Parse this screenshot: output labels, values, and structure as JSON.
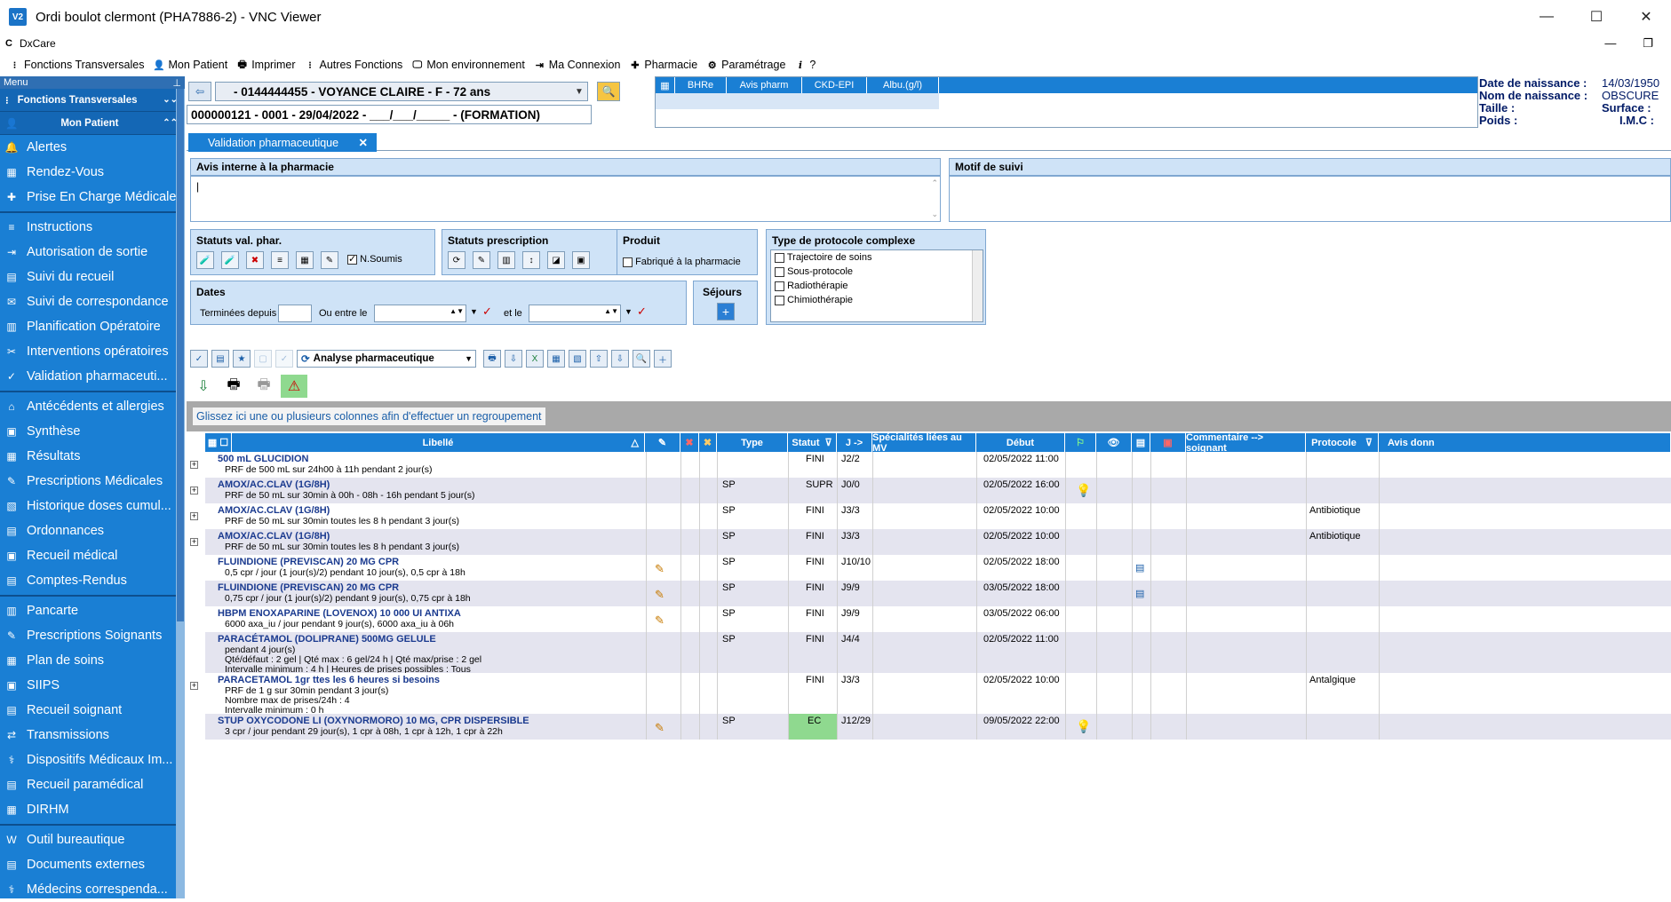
{
  "window": {
    "title": "Ordi boulot clermont (PHA7886-2) - VNC Viewer",
    "app_icon": "V2",
    "controls": [
      "—",
      "☐",
      "✕"
    ]
  },
  "dx": {
    "c": "C",
    "name": "DxCare",
    "controls": [
      "—",
      "❐"
    ]
  },
  "menubar": [
    {
      "icon": "⁝",
      "label": "Fonctions Transversales"
    },
    {
      "icon": "👤",
      "label": "Mon Patient"
    },
    {
      "icon": "🖶",
      "label": "Imprimer"
    },
    {
      "icon": "⁝",
      "label": "Autres Fonctions"
    },
    {
      "icon": "🖵",
      "label": "Mon environnement"
    },
    {
      "icon": "⇥",
      "label": "Ma Connexion"
    },
    {
      "icon": "✚",
      "label": "Pharmacie"
    },
    {
      "icon": "⚙",
      "label": "Paramétrage"
    },
    {
      "icon": "i",
      "label": "?"
    }
  ],
  "sidebar": {
    "header": "Menu",
    "pin": "⊥",
    "sections": [
      {
        "label": "Fonctions Transversales",
        "chev": "⌄⌄"
      },
      {
        "label": "Mon Patient",
        "chev": "⌃⌃"
      }
    ],
    "groups": [
      [
        "Alertes",
        "Rendez-Vous",
        "Prise En Charge Médicale"
      ],
      [
        "Instructions",
        "Autorisation de sortie",
        "Suivi du recueil",
        "Suivi de correspondance",
        "Planification Opératoire",
        "Interventions opératoires",
        "Validation  pharmaceuti..."
      ],
      [
        "Antécédents et allergies",
        "Synthèse",
        "Résultats",
        "Prescriptions Médicales",
        "Historique doses cumul...",
        "Ordonnances",
        "Recueil médical",
        "Comptes-Rendus"
      ],
      [
        "Pancarte",
        "Prescriptions Soignants",
        "Plan de soins",
        "SIIPS",
        "Recueil soignant",
        "Transmissions",
        "Dispositifs Médicaux Im...",
        "Recueil paramédical",
        "DIRHM"
      ],
      [
        "Outil bureautique",
        "Documents externes",
        "Médecins  correspenda..."
      ]
    ]
  },
  "patient": {
    "selector": "- 0144444455 - VOYANCE CLAIRE - F - 72 ans",
    "stay": "000000121 - 0001 - 29/04/2022 - ___/___/_____ - (FORMATION)"
  },
  "minitable": {
    "headers": [
      "BHRe",
      "Avis pharm",
      "CKD-EPI",
      "Albu.(g/l)"
    ]
  },
  "info": {
    "birth_label": "Date de naissance :",
    "birth_value": "14/03/1950",
    "birthname_label": "Nom de naissance :",
    "birthname_value": "OBSCURE",
    "height_label": "Taille :",
    "surface_label": "Surface :",
    "weight_label": "Poids :",
    "imc_label": "I.M.C :"
  },
  "tab": {
    "label": "Validation pharmaceutique",
    "close": "✕"
  },
  "panels": {
    "avis_title": "Avis interne à la pharmacie",
    "motif_title": "Motif de suivi"
  },
  "filters": {
    "statuts_val": "Statuts val. phar.",
    "n_soumis": "N.Soumis",
    "statuts_presc": "Statuts prescription",
    "produit": "Produit",
    "fabrique": "Fabriqué à la pharmacie",
    "type_proto": "Type de protocole complexe",
    "proto_items": [
      "Trajectoire de soins",
      "Sous-protocole",
      "Radiothérapie",
      "Chimiothérapie"
    ],
    "dates": "Dates",
    "terminees": "Terminées depuis",
    "ou_entre": "Ou entre le",
    "et_le": "et le",
    "sejours": "Séjours"
  },
  "toolbar": {
    "analyse": "Analyse pharmaceutique"
  },
  "group_hint": "Glissez ici une ou plusieurs colonnes afin d'effectuer un regroupement",
  "grid": {
    "headers": {
      "libelle": "Libellé",
      "type": "Type",
      "statut": "Statut",
      "j": "J ->",
      "specialites": "Spécialités liées au MV",
      "debut": "Début",
      "commentaire": "Commentaire --> soignant",
      "protocole": "Protocole",
      "avis": "Avis donn"
    },
    "rows": [
      {
        "name": "500 mL GLUCIDION",
        "sub": [
          "PRF de 500 mL sur 24h00 à 11h pendant 2 jour(s)"
        ],
        "type": "",
        "statut": "FINI",
        "j": "J2/2",
        "debut": "02/05/2022 11:00",
        "protocole": ""
      },
      {
        "name": "AMOX/AC.CLAV (1G/8H)",
        "sub": [
          "PRF de 50 mL sur 30min à 00h - 08h - 16h pendant 5 jour(s)"
        ],
        "type": "SP",
        "statut": "SUPR",
        "j": "J0/0",
        "debut": "02/05/2022 16:00",
        "protocole": ""
      },
      {
        "name": "AMOX/AC.CLAV (1G/8H)",
        "sub": [
          "PRF de 50 mL sur 30min toutes les 8 h pendant 3 jour(s)"
        ],
        "type": "SP",
        "statut": "FINI",
        "j": "J3/3",
        "debut": "02/05/2022 10:00",
        "protocole": "Antibiotique"
      },
      {
        "name": "AMOX/AC.CLAV (1G/8H)",
        "sub": [
          "PRF de 50 mL sur 30min toutes les 8 h pendant 3 jour(s)"
        ],
        "type": "SP",
        "statut": "FINI",
        "j": "J3/3",
        "debut": "02/05/2022 10:00",
        "protocole": "Antibiotique"
      },
      {
        "name": "FLUINDIONE (PREVISCAN) 20 MG CPR",
        "sub": [
          "0,5 cpr / jour (1 jour(s)/2) pendant 10 jour(s), 0,5 cpr à 18h"
        ],
        "type": "SP",
        "statut": "FINI",
        "j": "J10/10",
        "debut": "02/05/2022 18:00",
        "protocole": ""
      },
      {
        "name": "FLUINDIONE (PREVISCAN) 20 MG CPR",
        "sub": [
          "0,75 cpr / jour (1 jour(s)/2) pendant 9 jour(s), 0,75 cpr à 18h"
        ],
        "type": "SP",
        "statut": "FINI",
        "j": "J9/9",
        "debut": "03/05/2022 18:00",
        "protocole": ""
      },
      {
        "name": "HBPM ENOXAPARINE (LOVENOX) 10 000 UI ANTIXA",
        "sub": [
          "6000 axa_iu / jour pendant 9 jour(s), 6000 axa_iu à 06h"
        ],
        "type": "SP",
        "statut": "FINI",
        "j": "J9/9",
        "debut": "03/05/2022 06:00",
        "protocole": ""
      },
      {
        "name": "PARACÉTAMOL (DOLIPRANE) 500MG GELULE",
        "sub": [
          "pendant 4 jour(s)",
          "Qté/défaut : 2 gel | Qté max : 6 gel/24 h | Qté max/prise : 2 gel",
          "Intervalle minimum : 4 h | Heures de prises possibles : Tous"
        ],
        "type": "SP",
        "statut": "FINI",
        "j": "J4/4",
        "debut": "02/05/2022 11:00",
        "protocole": ""
      },
      {
        "name": "PARACETAMOL 1gr ttes les 6 heures si besoins",
        "sub": [
          "PRF de 1 g sur 30min pendant 3 jour(s)",
          "Nombre max de prises/24h : 4",
          "Intervalle minimum : 0 h"
        ],
        "type": "",
        "statut": "FINI",
        "j": "J3/3",
        "debut": "02/05/2022 10:00",
        "protocole": "Antalgique"
      },
      {
        "name": "STUP OXYCODONE LI (OXYNORMORO) 10 MG, CPR DISPERSIBLE",
        "sub": [
          "3 cpr / jour pendant 29 jour(s), 1 cpr à 08h, 1 cpr à 12h, 1 cpr à 22h"
        ],
        "type": "SP",
        "statut": "EC",
        "j": "J12/29",
        "debut": "09/05/2022 22:00",
        "protocole": ""
      }
    ]
  },
  "colors": {
    "accent": "#1a7fd4",
    "ec_status": "#8fd98f",
    "row_alt": "#e4e4ef"
  }
}
